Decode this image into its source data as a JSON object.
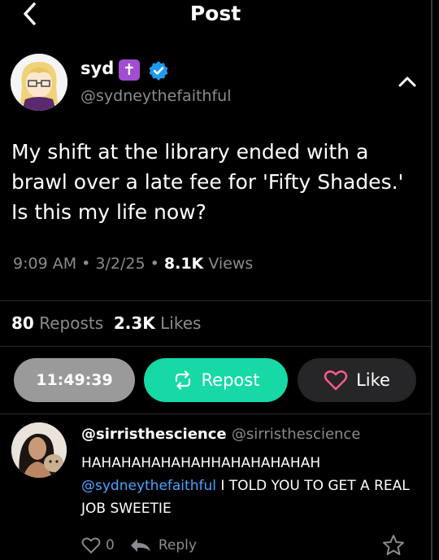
{
  "header": {
    "title": "Post"
  },
  "post": {
    "author_name": "syd",
    "badge_glyph": "✝",
    "handle": "@sydneythefaithful",
    "text": "My shift at the library ended with a brawl over a late fee for 'Fifty Shades.' Is this my life now?",
    "time": "9:09 AM",
    "sep1": "•",
    "date": "3/2/25",
    "sep2": "•",
    "views_count": "8.1K",
    "views_label": "Views",
    "reposts_count": "80",
    "reposts_label": "Reposts",
    "likes_count": "2.3K",
    "likes_label": "Likes"
  },
  "actions": {
    "timer": "11:49:39",
    "repost_label": "Repost",
    "like_label": "Like"
  },
  "reply": {
    "author_name": "@sirristhescience",
    "handle": "@sirristhescience",
    "line1": "HAHAHAHAHAHAHHAHAHAHAHAH",
    "mention": "@sydneythefaithful",
    "line2_rest": " I TOLD YOU TO GET A REAL JOB SWEETIE",
    "like_count": "0",
    "reply_label": "Reply"
  },
  "icons": {
    "back": "chevron-left-icon",
    "verified": "verified-check-icon",
    "collapse": "chevron-up-icon",
    "repost": "repost-arrows-icon",
    "like": "heart-outline-icon",
    "reply": "reply-arrow-icon",
    "bookmark": "star-outline-icon"
  },
  "colors": {
    "background": "#000000",
    "accent_green": "#16d9a6",
    "mention_blue": "#4aa3ff",
    "heart_pink": "#ff5c8a",
    "verified_blue": "#1d9bf0",
    "badge_purple": "#a14dcf"
  }
}
